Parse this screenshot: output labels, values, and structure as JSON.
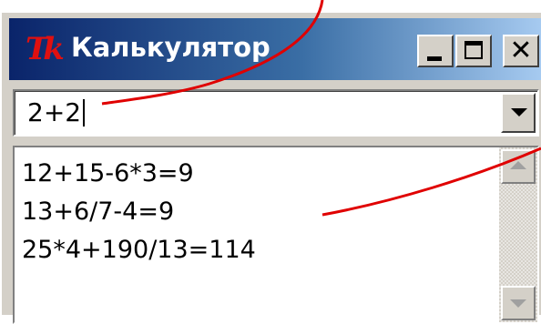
{
  "window": {
    "title": "Калькулятор",
    "icon": "tk-feather-icon",
    "controls": [
      "minimize-icon",
      "maximize-icon",
      "close-icon"
    ],
    "close_glyph": "✕"
  },
  "expression_input": {
    "value": "2+2"
  },
  "history": {
    "items": [
      "12+15-6*3=9",
      "13+6/7-4=9",
      "25*4+190/13=114"
    ]
  },
  "colors": {
    "titlebar_start": "#0a246a",
    "titlebar_end": "#a6caf0",
    "annotation_line": "#e00000",
    "window_face": "#d4d0c8"
  }
}
